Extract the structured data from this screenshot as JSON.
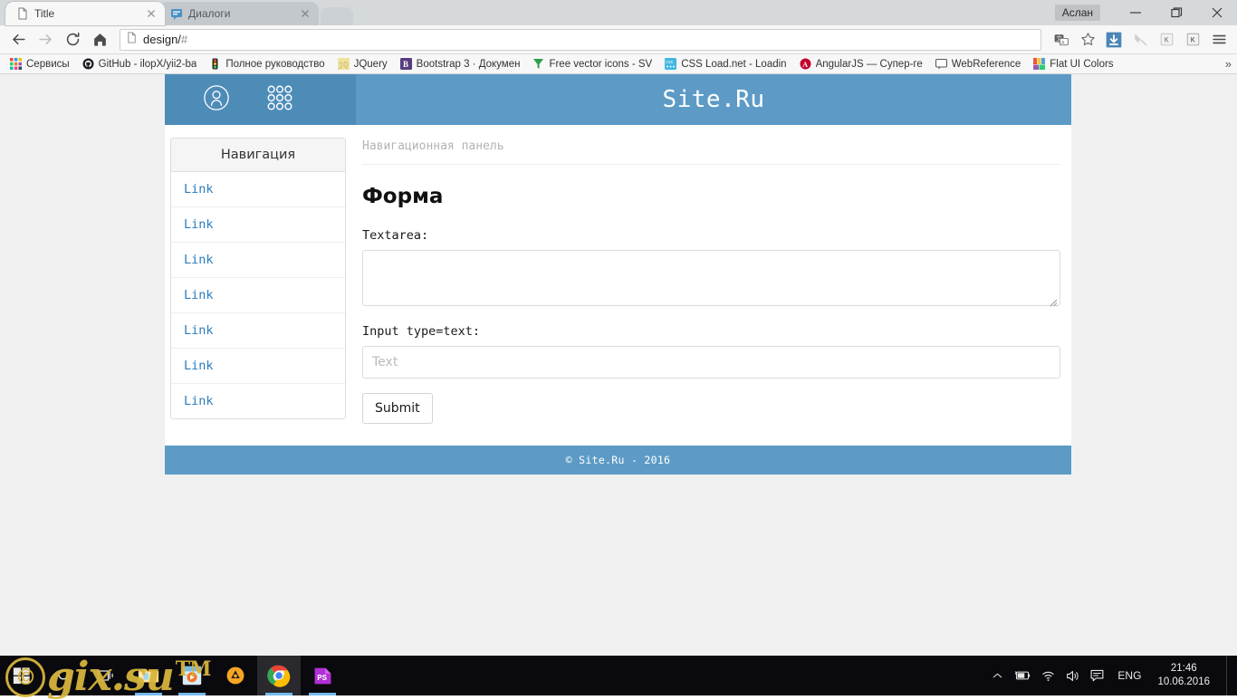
{
  "browser": {
    "tabs": [
      {
        "title": "Title",
        "favicon": "page-icon",
        "active": true
      },
      {
        "title": "Диалоги",
        "favicon": "chat-icon",
        "active": false
      }
    ],
    "window_user": "Аслан",
    "window_buttons": {
      "minimize": "minimize-button",
      "maximize": "maximize-button",
      "close": "close-button"
    },
    "toolbar": {
      "back": "back-button",
      "forward": "forward-button",
      "reload": "reload-button",
      "home": "home-button",
      "url": "design/",
      "url_fragment": "#",
      "translate": "translate-icon",
      "bookmark_star": "star-icon",
      "download": "download-icon",
      "kaspersky_anti_banner": "anti-banner-icon",
      "kaspersky_1": "kaspersky-icon",
      "kaspersky_2": "kaspersky-icon",
      "menu": "menu-icon"
    },
    "bookmarks": [
      {
        "label": "Сервисы",
        "icon_color": "#f0b000"
      },
      {
        "label": "GitHub - ilopX/yii2-ba",
        "icon_color": "#1b1f23"
      },
      {
        "label": "Полное руководство",
        "icon_color": "#d0342c"
      },
      {
        "label": "JQuery",
        "icon_color": "#efe3a0"
      },
      {
        "label": "Bootstrap 3 · Докумен",
        "icon_color": "#563d7c"
      },
      {
        "label": "Free vector icons - SV",
        "icon_color": "#2e9e4b"
      },
      {
        "label": "CSS Load.net - Loadin",
        "icon_color": "#3fb7e0"
      },
      {
        "label": "AngularJS — Супер-ге",
        "icon_color": "#c3002f"
      },
      {
        "label": "WebReference",
        "icon_color": "#f4f4f4"
      },
      {
        "label": "Flat UI Colors",
        "icon_color": "#e8563f"
      }
    ],
    "bookmarks_overflow": "»"
  },
  "page": {
    "header": {
      "user_icon": "user-circle-icon",
      "grid_icon": "grid-dots-icon",
      "title": "Site.Ru"
    },
    "sidebar": {
      "heading": "Навигация",
      "links": [
        "Link",
        "Link",
        "Link",
        "Link",
        "Link",
        "Link",
        "Link"
      ]
    },
    "breadcrumb": "Навигационная панель",
    "form": {
      "title": "Форма",
      "textarea_label": "Textarea:",
      "textarea_value": "",
      "text_label": "Input type=text:",
      "text_value": "",
      "text_placeholder": "Text",
      "submit_label": "Submit"
    },
    "footer": "© Site.Ru - 2016",
    "colors": {
      "header_left": "#4e8cb8",
      "header_right": "#5d9bc6",
      "footer": "#5d9bc6",
      "link": "#2b7dbd",
      "page_bg": "#f0f0f0"
    }
  },
  "taskbar": {
    "start": "windows-start-icon",
    "search": "search-icon",
    "task_view": "task-view-icon",
    "apps": [
      {
        "name": "file-explorer-icon",
        "running": true,
        "active": false
      },
      {
        "name": "media-player-icon",
        "running": true,
        "active": false
      },
      {
        "name": "aimp-icon",
        "running": false,
        "active": false
      },
      {
        "name": "chrome-icon",
        "running": true,
        "active": true
      },
      {
        "name": "photoshop-icon",
        "running": true,
        "active": false
      }
    ],
    "tray": {
      "show_hidden": "chevron-up-icon",
      "battery": "battery-charging-icon",
      "network": "wifi-icon",
      "volume": "speaker-icon",
      "action_center": "notifications-icon",
      "language": "ENG",
      "time": "21:46",
      "date": "10.06.2016"
    }
  },
  "watermark": {
    "circle": "©",
    "text": "gix.su",
    "tm": "TM"
  }
}
